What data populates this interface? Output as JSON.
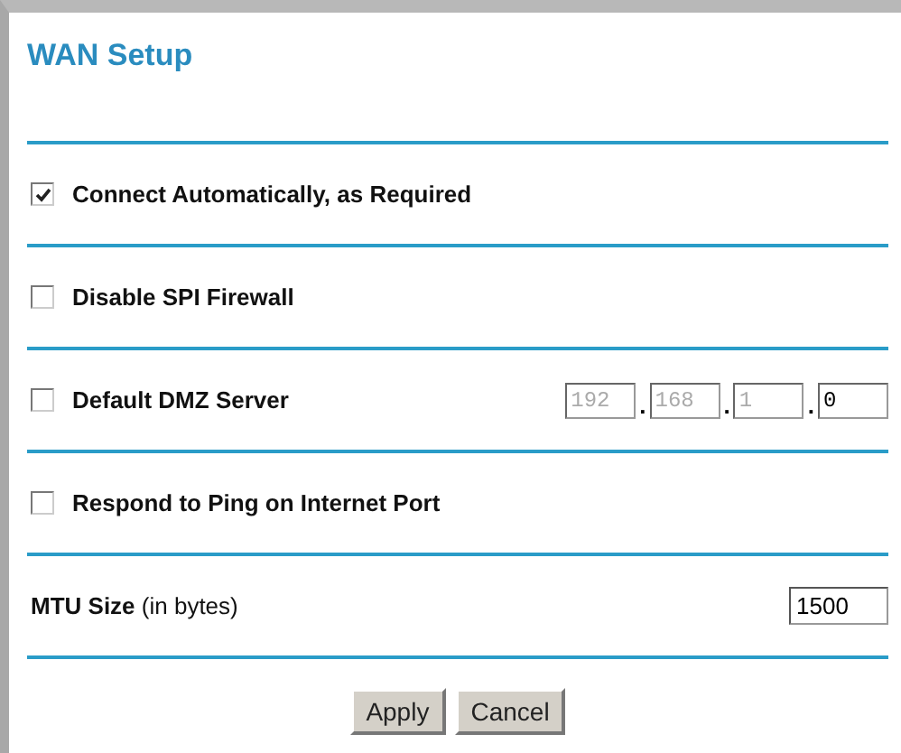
{
  "title": "WAN Setup",
  "rows": [
    {
      "kind": "check",
      "label": "Connect Automatically, as Required",
      "checked": true
    },
    {
      "kind": "check",
      "label": "Disable SPI Firewall",
      "checked": false
    },
    {
      "kind": "ip",
      "label": "Default DMZ Server",
      "checked": false,
      "separator": ".",
      "octets": [
        {
          "value": "192",
          "disabled": true
        },
        {
          "value": "168",
          "disabled": true
        },
        {
          "value": "1",
          "disabled": true
        },
        {
          "value": "0",
          "disabled": false
        }
      ]
    },
    {
      "kind": "check",
      "label": "Respond to Ping on Internet Port",
      "checked": false
    },
    {
      "kind": "field",
      "label": "**MTU Size** (in bytes)",
      "value": "1500"
    }
  ],
  "buttons": [
    "Apply",
    "Cancel"
  ]
}
